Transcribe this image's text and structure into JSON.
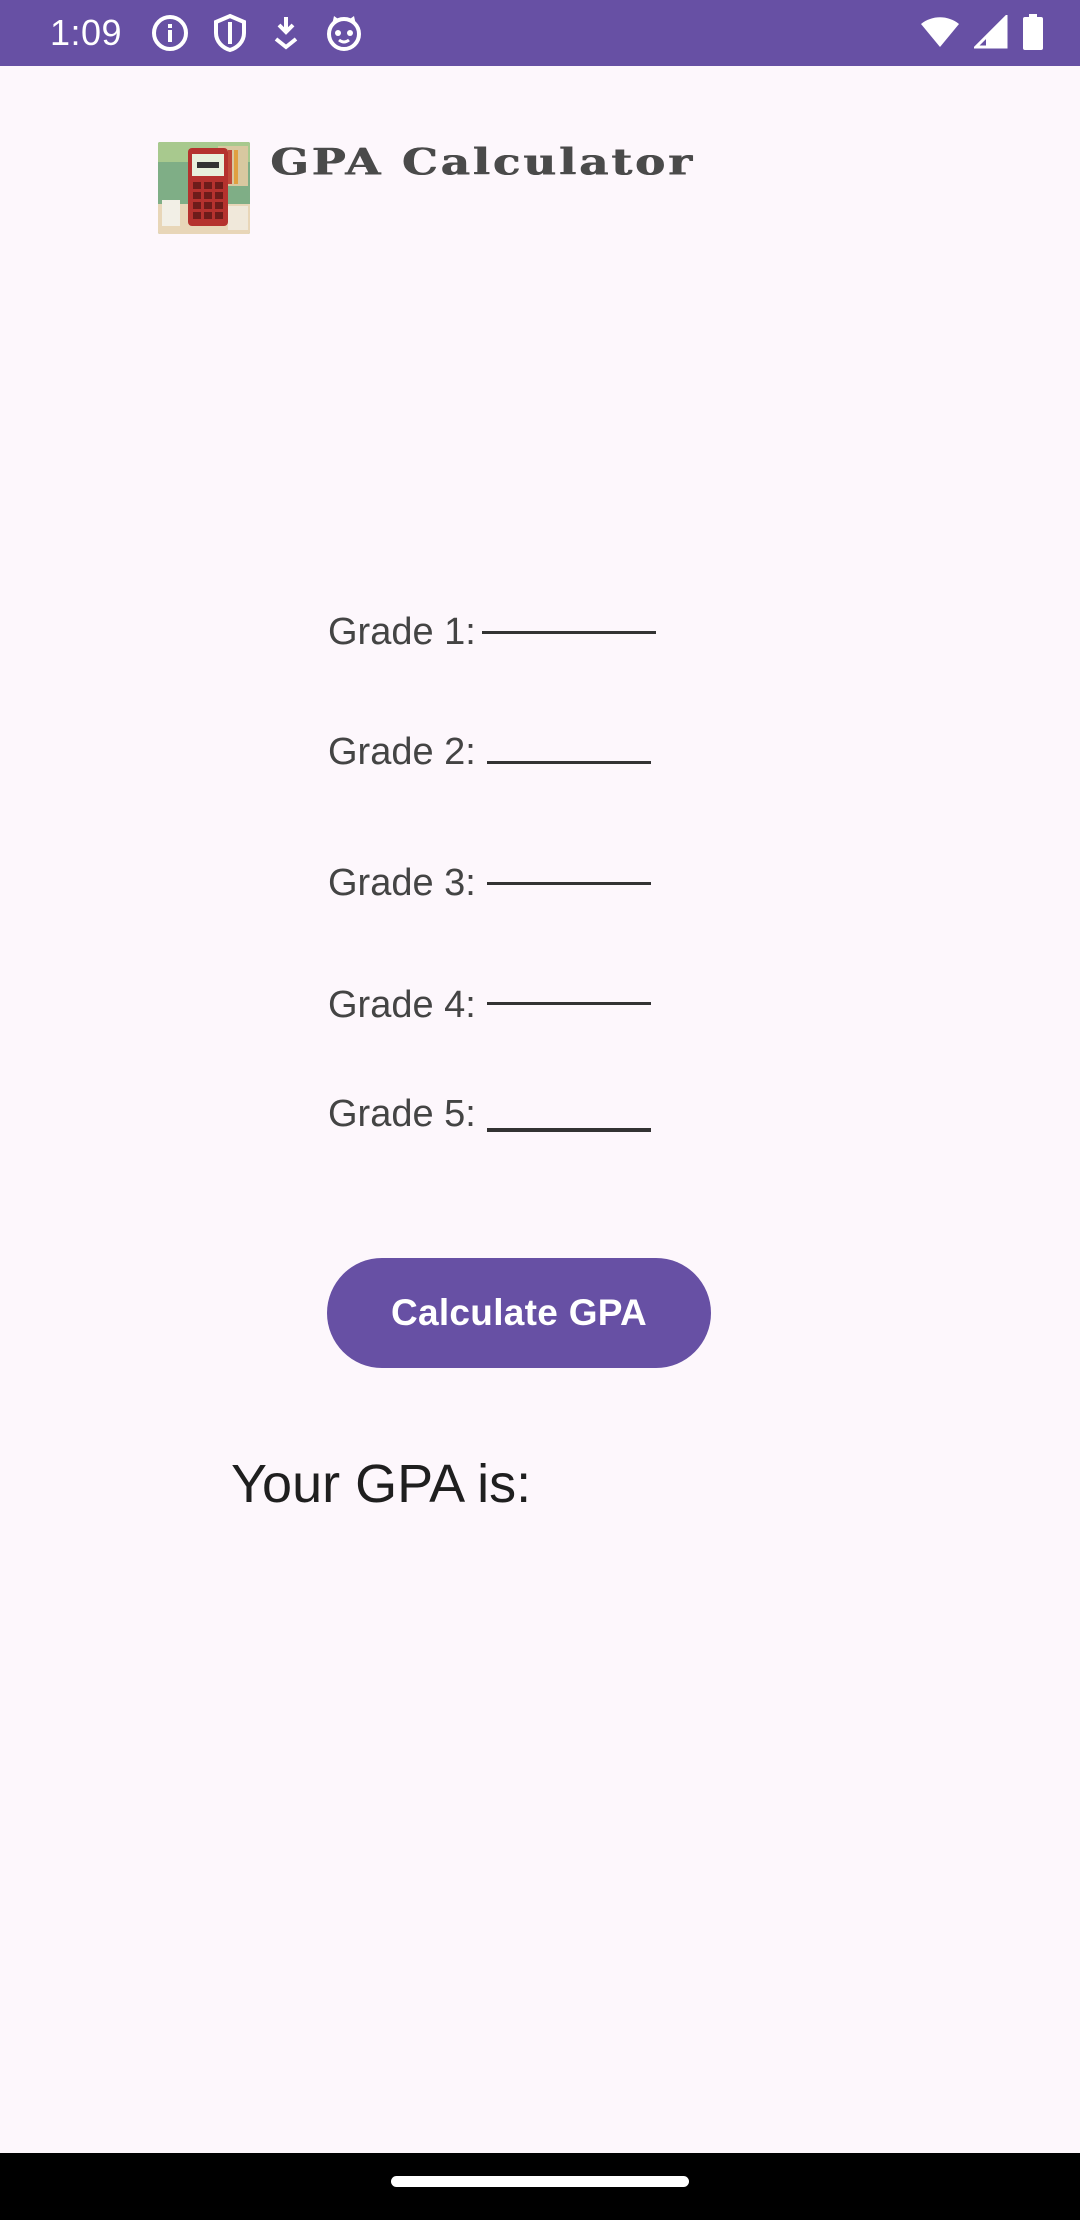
{
  "status_bar": {
    "time": "1:09",
    "left_icons": [
      "info-icon",
      "shield-icon",
      "download-icon",
      "cat-face-icon"
    ],
    "right_icons": [
      "wifi-icon",
      "signal-icon",
      "battery-icon"
    ],
    "background_color": "#6750A4"
  },
  "header": {
    "title": "GPA Calculator",
    "logo_icon": "calculator-icon"
  },
  "grades": [
    {
      "label": "Grade 1:",
      "value": ""
    },
    {
      "label": "Grade 2:",
      "value": ""
    },
    {
      "label": "Grade 3:",
      "value": ""
    },
    {
      "label": "Grade 4:",
      "value": ""
    },
    {
      "label": "Grade 5:",
      "value": ""
    }
  ],
  "calculate_button": {
    "label": "Calculate GPA",
    "color": "#6750A4"
  },
  "result": {
    "label": "Your GPA is:"
  },
  "colors": {
    "background": "#FDF7FC",
    "accent": "#6750A4"
  }
}
